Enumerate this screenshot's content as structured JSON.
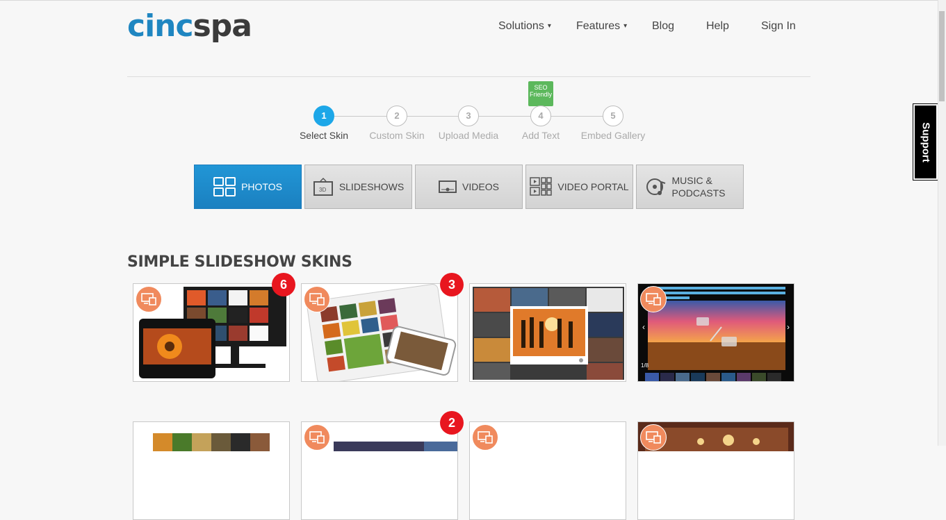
{
  "logo": {
    "part1": "cinc",
    "part2": "spa"
  },
  "nav": {
    "solutions": "Solutions",
    "features": "Features",
    "blog": "Blog",
    "help": "Help",
    "signin": "Sign In",
    "caret": "▾"
  },
  "seo_badge": "SEO Friendly",
  "steps": [
    {
      "num": "1",
      "label": "Select Skin",
      "active": true
    },
    {
      "num": "2",
      "label": "Custom Skin",
      "active": false
    },
    {
      "num": "3",
      "label": "Upload Media",
      "active": false
    },
    {
      "num": "4",
      "label": "Add Text",
      "active": false
    },
    {
      "num": "5",
      "label": "Embed Gallery",
      "active": false
    }
  ],
  "tabs": [
    {
      "label": "PHOTOS",
      "icon": "photo-grid-icon",
      "active": true
    },
    {
      "label": "SLIDESHOWS",
      "icon": "3d-slideshow-icon",
      "active": false
    },
    {
      "label": "VIDEOS",
      "icon": "video-screen-icon",
      "active": false
    },
    {
      "label": "VIDEO PORTAL",
      "icon": "video-portal-icon",
      "active": false
    },
    {
      "label": "MUSIC & PODCASTS",
      "icon": "music-disc-icon",
      "active": false
    }
  ],
  "section_title": "SIMPLE SLIDESHOW SKINS",
  "cards_row1": [
    {
      "badge": "6",
      "slide_counter": ""
    },
    {
      "badge": "3",
      "slide_counter": ""
    },
    {
      "badge": "",
      "slide_counter": ""
    },
    {
      "badge": "",
      "slide_counter": "1/8"
    }
  ],
  "cards_row2": [
    {
      "badge": ""
    },
    {
      "badge": "2"
    },
    {
      "badge": ""
    },
    {
      "badge": ""
    }
  ],
  "support_label": "Support",
  "colors": {
    "accent_blue": "#1da7e8",
    "tab_active": "#1b80c0",
    "badge_red": "#e8161f",
    "device_badge": "#f08a5d",
    "seo_green": "#5cb85c"
  }
}
